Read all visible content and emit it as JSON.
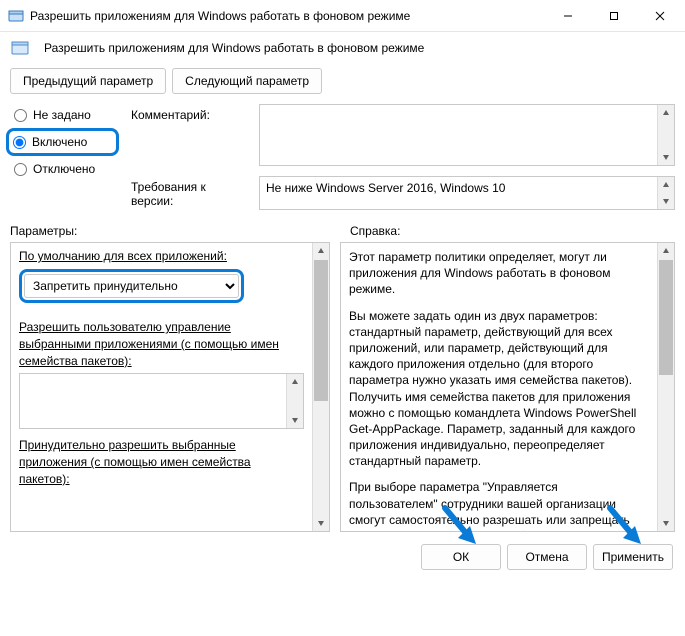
{
  "window": {
    "title": "Разрешить приложениям для Windows работать в фоновом режиме",
    "subtitle": "Разрешить приложениям для Windows работать в фоновом режиме"
  },
  "nav": {
    "prev": "Предыдущий параметр",
    "next": "Следующий параметр"
  },
  "radios": {
    "not_configured": "Не задано",
    "enabled": "Включено",
    "disabled": "Отключено",
    "selected": "enabled"
  },
  "meta": {
    "comment_label": "Комментарий:",
    "comment_value": "",
    "req_label": "Требования к версии:",
    "req_value": "Не ниже Windows Server 2016, Windows 10"
  },
  "sections": {
    "options": "Параметры:",
    "help": "Справка:"
  },
  "options": {
    "default_label": "По умолчанию для всех приложений:",
    "default_value": "Запретить принудительно",
    "user_control_label": "Разрешить пользователю управление выбранными приложениями (с помощью имен семейства пакетов):",
    "force_allow_label": "Принудительно разрешить выбранные приложения (с помощью имен семейства пакетов):"
  },
  "help": {
    "p1": "Этот параметр политики определяет, могут ли приложения для Windows работать в фоновом режиме.",
    "p2": "Вы можете задать один из двух параметров: стандартный параметр, действующий для всех приложений, или параметр, действующий для каждого приложения отдельно (для второго параметра нужно указать имя семейства пакетов). Получить имя семейства пакетов для приложения можно с помощью командлета Windows PowerShell Get-AppPackage. Параметр, заданный для каждого приложения индивидуально, переопределяет стандартный параметр.",
    "p3": "При выборе параметра \"Управляется пользователем\" сотрудники вашей организации смогут самостоятельно разрешать или запрещать приложениям для Windows работать в фоновом режиме. Для этого необходимо выбрать элементы \"Параметры\" > \"Конфиденциальность\" на устройстве."
  },
  "buttons": {
    "ok": "ОК",
    "cancel": "Отмена",
    "apply": "Применить"
  }
}
